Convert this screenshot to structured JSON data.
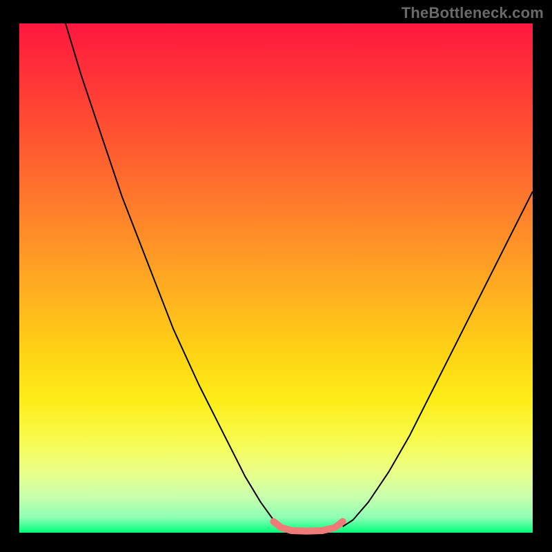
{
  "watermark": {
    "text": "TheBottleneck.com"
  },
  "chart_data": {
    "type": "line",
    "title": "",
    "xlabel": "",
    "ylabel": "",
    "xlim": [
      0,
      100
    ],
    "ylim": [
      0,
      100
    ],
    "grid": false,
    "legend": false,
    "annotations": [],
    "background_gradient": {
      "direction": "vertical",
      "stops": [
        {
          "pos": 0.0,
          "color": "#ff183f"
        },
        {
          "pos": 0.5,
          "color": "#ffb31f"
        },
        {
          "pos": 0.8,
          "color": "#f8fb50"
        },
        {
          "pos": 1.0,
          "color": "#00ff7a"
        }
      ]
    },
    "series": [
      {
        "name": "left-branch",
        "stroke": "#000000",
        "stroke_width": 2,
        "x": [
          9,
          12,
          16,
          20,
          25,
          30,
          35,
          40,
          44,
          47,
          49.5,
          51
        ],
        "y": [
          100,
          90,
          78,
          66,
          53,
          40,
          29,
          19,
          11,
          6,
          2.5,
          1.2
        ]
      },
      {
        "name": "right-branch",
        "stroke": "#000000",
        "stroke_width": 2,
        "x": [
          63,
          65,
          68,
          72,
          76,
          80,
          84,
          88,
          92,
          96,
          100
        ],
        "y": [
          1.2,
          2.5,
          6,
          12,
          19,
          27,
          35,
          43,
          51,
          59,
          67
        ]
      },
      {
        "name": "valley-highlight",
        "stroke": "#ef7a78",
        "stroke_width": 10,
        "linecap": "round",
        "x": [
          49.5,
          51,
          53,
          56,
          59,
          61.5,
          63
        ],
        "y": [
          2.2,
          1.0,
          0.4,
          0.3,
          0.4,
          1.0,
          2.2
        ]
      }
    ]
  }
}
